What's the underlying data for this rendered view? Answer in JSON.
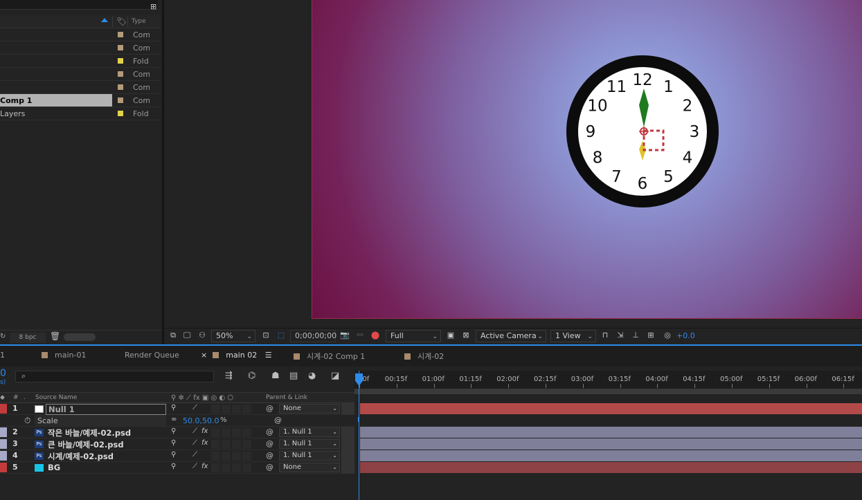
{
  "project": {
    "type_header": "Type",
    "bpc": "8 bpc",
    "items": [
      {
        "name": "",
        "type": "Com",
        "color": "#b59b7a",
        "selected": false
      },
      {
        "name": "",
        "type": "Com",
        "color": "#b59b7a",
        "selected": false
      },
      {
        "name": "",
        "type": "Fold",
        "color": "#e3d24a",
        "selected": false
      },
      {
        "name": "",
        "type": "Com",
        "color": "#b59b7a",
        "selected": false
      },
      {
        "name": "",
        "type": "Com",
        "color": "#b59b7a",
        "selected": false
      },
      {
        "name": "Comp 1",
        "type": "Com",
        "color": "#b59b7a",
        "selected": true
      },
      {
        "name": "Layers",
        "type": "Fold",
        "color": "#e3d24a",
        "selected": false
      }
    ]
  },
  "clock": {
    "numbers": [
      "12",
      "1",
      "2",
      "3",
      "4",
      "5",
      "6",
      "7",
      "8",
      "9",
      "10",
      "11"
    ]
  },
  "viewer": {
    "zoom": "50%",
    "timecode": "0;00;00;00",
    "resolution": "Full",
    "camera": "Active Camera",
    "views": "1 View",
    "exposure": "+0.0"
  },
  "tabs": [
    {
      "label": "main-01",
      "active": false
    },
    {
      "label": "Render Queue",
      "active": false
    },
    {
      "label": "main 02",
      "active": true
    },
    {
      "label": "시계-02 Comp 1",
      "active": false
    },
    {
      "label": "시계-02",
      "active": false
    }
  ],
  "timeline": {
    "current_time": "0",
    "header": {
      "num": "#",
      "source": "Source Name",
      "parent": "Parent & Link"
    },
    "ruler": [
      "00f",
      "00:15f",
      "01:00f",
      "01:15f",
      "02:00f",
      "02:15f",
      "03:00f",
      "03:15f",
      "04:00f",
      "04:15f",
      "05:00f",
      "05:15f",
      "06:00f",
      "06:15f"
    ],
    "layers": [
      {
        "num": "1",
        "name": "Null 1",
        "parent": "None",
        "label": "#c43b3b",
        "icon": "null",
        "fx": false,
        "bar": "#b24a4a"
      },
      {
        "num": "2",
        "name": "작은 바늘/예제-02.psd",
        "parent": "1. Null 1",
        "label": "#a8a8c8",
        "icon": "psd",
        "fx": true,
        "bar": "#7f7f9a"
      },
      {
        "num": "3",
        "name": "큰 바늘/예제-02.psd",
        "parent": "1. Null 1",
        "label": "#a8a8c8",
        "icon": "psd",
        "fx": true,
        "bar": "#7f7f9a"
      },
      {
        "num": "4",
        "name": "시계/예제-02.psd",
        "parent": "1. Null 1",
        "label": "#a8a8c8",
        "icon": "psd",
        "fx": false,
        "bar": "#7f7f9a"
      },
      {
        "num": "5",
        "name": "BG",
        "parent": "None",
        "label": "#c43b3b",
        "icon": "solid",
        "fx": true,
        "bar": "#8e4246"
      }
    ],
    "scale_prop": {
      "label": "Scale",
      "value": "50.0,50.0",
      "unit": "%"
    }
  },
  "colors": {
    "accent": "#2d8ceb",
    "null_bar": "#b24a4a",
    "psd_bar": "#7f7f9a",
    "bg_bar": "#8e4246"
  }
}
